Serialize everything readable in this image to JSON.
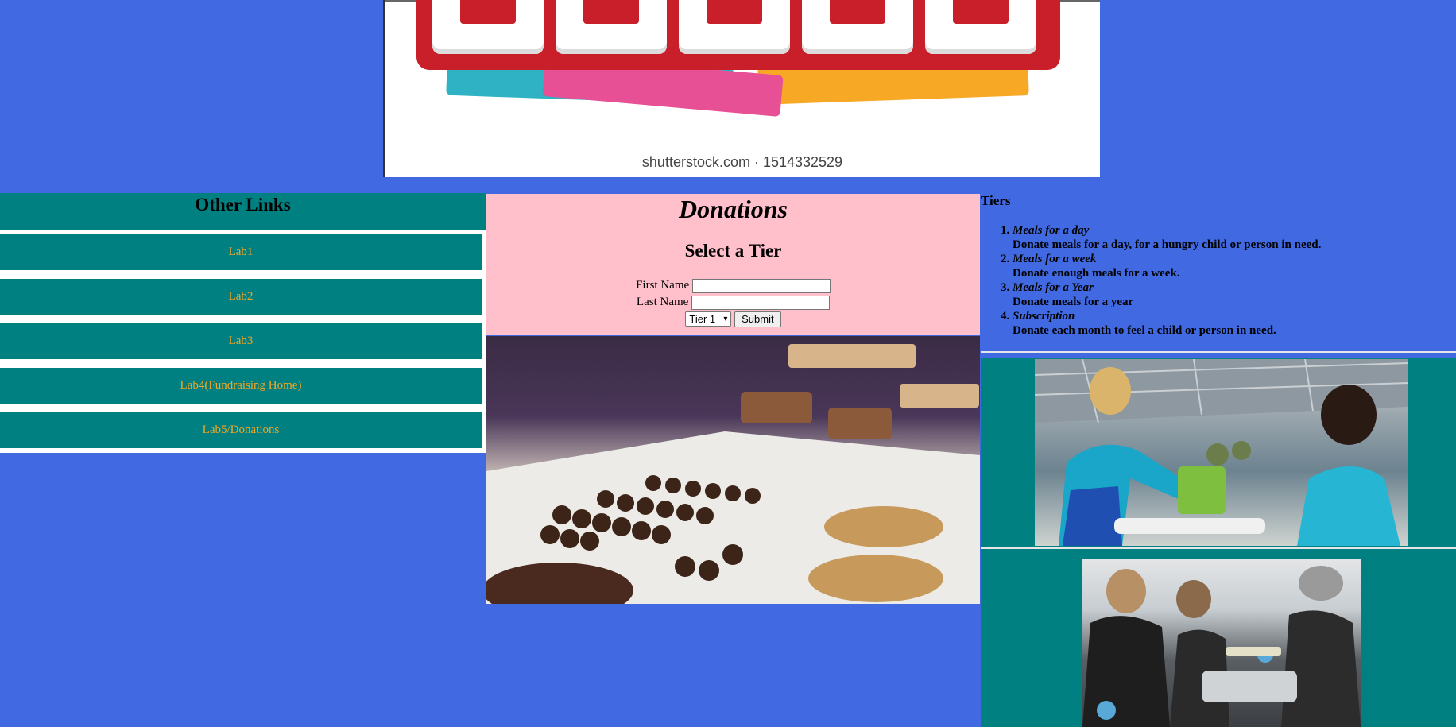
{
  "banner": {
    "alt": "Event banner",
    "credit": "shutterstock.com · 1514332529",
    "colors": {
      "board": "#c81f2a",
      "teal": "#2fb2c3",
      "pink": "#e85096",
      "orange": "#f7a825"
    }
  },
  "nav": {
    "title": "Other Links",
    "items": [
      {
        "label": "Lab1"
      },
      {
        "label": "Lab2"
      },
      {
        "label": "Lab3"
      },
      {
        "label": "Lab4(Fundraising Home)"
      },
      {
        "label": "Lab5/Donations"
      }
    ]
  },
  "donations": {
    "title": "Donations",
    "subtitle": "Select a Tier",
    "first_name_label": "First Name",
    "last_name_label": "Last Name",
    "first_name_value": "",
    "last_name_value": "",
    "tier_selected": "Tier 1",
    "submit_label": "Submit"
  },
  "tiers": {
    "title": "Tiers",
    "items": [
      {
        "name": "Meals for a day",
        "desc": "Donate meals for a day, for a hungry child or person in need."
      },
      {
        "name": "Meals for a week",
        "desc": "Donate enough meals for a week."
      },
      {
        "name": "Meals for a Year",
        "desc": "Donate meals for a year"
      },
      {
        "name": "Subscription",
        "desc": "Donate each month to feel a child or person in need."
      }
    ]
  },
  "colors": {
    "page_bg": "#4169e1",
    "nav_bg": "#008080",
    "nav_link": "#f5a623",
    "donate_bg": "#ffc0cb"
  }
}
